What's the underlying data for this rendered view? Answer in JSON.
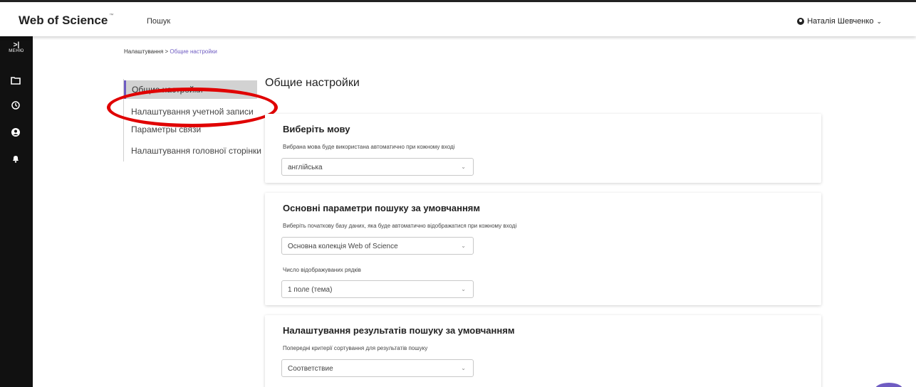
{
  "header": {
    "brand": "Web of Science",
    "brand_tm": "™",
    "nav_search": "Пошук",
    "user_name": "Наталія Шевченко"
  },
  "rail": {
    "menu_label": "МЕНЮ",
    "icons": [
      "folder-icon",
      "history-icon",
      "user-circle-icon",
      "bell-icon"
    ]
  },
  "breadcrumb": {
    "parent": "Налаштування",
    "separator": " > ",
    "current": "Общие настройки"
  },
  "leftnav": {
    "items": [
      {
        "label": "Общие настройки"
      },
      {
        "label": "Налаштування учетной записи"
      },
      {
        "label": "Параметры связи"
      },
      {
        "label": "Налаштування головної сторінки"
      }
    ]
  },
  "page_title": "Общие настройки",
  "language_card": {
    "title": "Виберіть мову",
    "description": "Вибрана мова буде використана автоматично при кожному вході",
    "select_value": "англійська"
  },
  "search_card": {
    "title": "Основні параметри пошуку за умовчанням",
    "db_description": "Виберіть початкову базу даних, яка буде автоматично відображатися при кожному вході",
    "db_value": "Основна колекція Web of Science",
    "rows_label": "Число відображуваних рядків",
    "rows_value": "1 поле (тема)"
  },
  "results_card": {
    "title": "Налаштування результатів пошуку за умовчанням",
    "sort_description": "Попередні критерії сортування для результатів пошуку",
    "sort_value": "Соответствие"
  },
  "colors": {
    "accent": "#6f5cc2",
    "annotation": "#e00000",
    "rail": "#111111"
  }
}
